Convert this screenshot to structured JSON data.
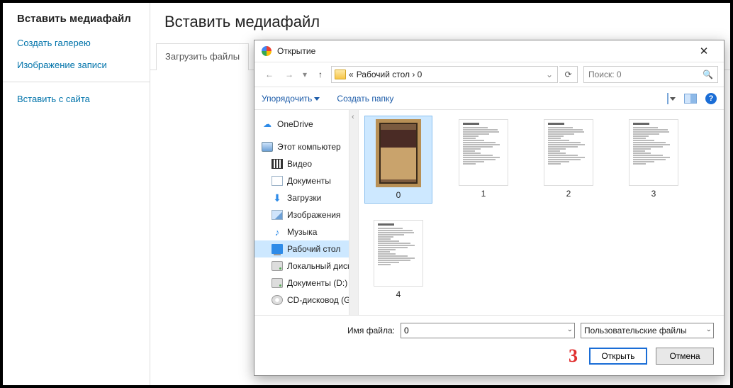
{
  "media_panel": {
    "title": "Вставить медиафайл",
    "links": {
      "gallery": "Создать галерею",
      "featured": "Изображение записи",
      "from_url": "Вставить с сайта"
    },
    "main_title": "Вставить медиафайл",
    "tab_upload": "Загрузить файлы"
  },
  "dialog": {
    "title": "Открытие",
    "breadcrumb_prefix": "«",
    "breadcrumb": "Рабочий стол  ›  0",
    "search_placeholder": "Поиск: 0",
    "organize": "Упорядочить",
    "new_folder": "Создать папку",
    "tree": {
      "onedrive": "OneDrive",
      "this_pc": "Этот компьютер",
      "videos": "Видео",
      "documents": "Документы",
      "downloads": "Загрузки",
      "pictures": "Изображения",
      "music": "Музыка",
      "desktop": "Рабочий стол",
      "local_disk": "Локальный диск",
      "docs_d": "Документы (D:)",
      "cd": "CD-дисковод (G:)"
    },
    "files": [
      {
        "name": "0",
        "kind": "painting",
        "selected": true
      },
      {
        "name": "1",
        "kind": "page"
      },
      {
        "name": "2",
        "kind": "page"
      },
      {
        "name": "3",
        "kind": "page"
      },
      {
        "name": "4",
        "kind": "page"
      }
    ],
    "filename_label": "Имя файла:",
    "filename_value": "0",
    "filetype": "Пользовательские файлы",
    "open": "Открыть",
    "cancel": "Отмена",
    "annotation": "3"
  }
}
